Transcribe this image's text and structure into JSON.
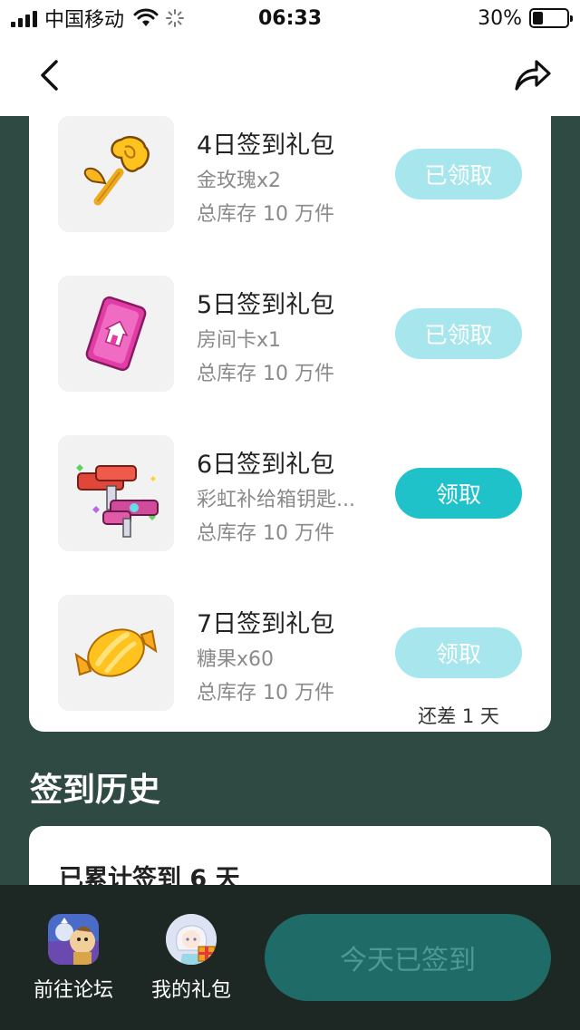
{
  "status_bar": {
    "carrier": "中国移动",
    "time": "06:33",
    "battery": "30%",
    "battery_level": 0.3
  },
  "nav": {
    "back_icon": "chevron-left-icon",
    "share_icon": "share-arrow-icon"
  },
  "gifts": [
    {
      "title": "4日签到礼包",
      "desc": "金玫瑰x2",
      "stock": "总库存 10 万件",
      "button": "已领取",
      "state": "done",
      "icon": "golden-rose-icon"
    },
    {
      "title": "5日签到礼包",
      "desc": "房间卡x1",
      "stock": "总库存 10 万件",
      "button": "已领取",
      "state": "done",
      "icon": "room-card-icon"
    },
    {
      "title": "6日签到礼包",
      "desc": "彩虹补给箱钥匙...",
      "stock": "总库存 10 万件",
      "button": "领取",
      "state": "active",
      "icon": "rainbow-keys-icon"
    },
    {
      "title": "7日签到礼包",
      "desc": "糖果x60",
      "stock": "总库存 10 万件",
      "button": "领取",
      "state": "pending",
      "icon": "candy-icon",
      "note": "还差 1 天"
    }
  ],
  "history": {
    "title": "签到历史",
    "summary": "已累计签到 6 天"
  },
  "bottom_bar": {
    "forum_label": "前往论坛",
    "my_gifts_label": "我的礼包",
    "checkin_label": "今天已签到"
  },
  "colors": {
    "background": "#2f4a42",
    "accent": "#1fc2c9",
    "accent_light": "#a6e6ec",
    "bottom_bar": "#1d2825",
    "checkin_button": "#1f6b67"
  }
}
